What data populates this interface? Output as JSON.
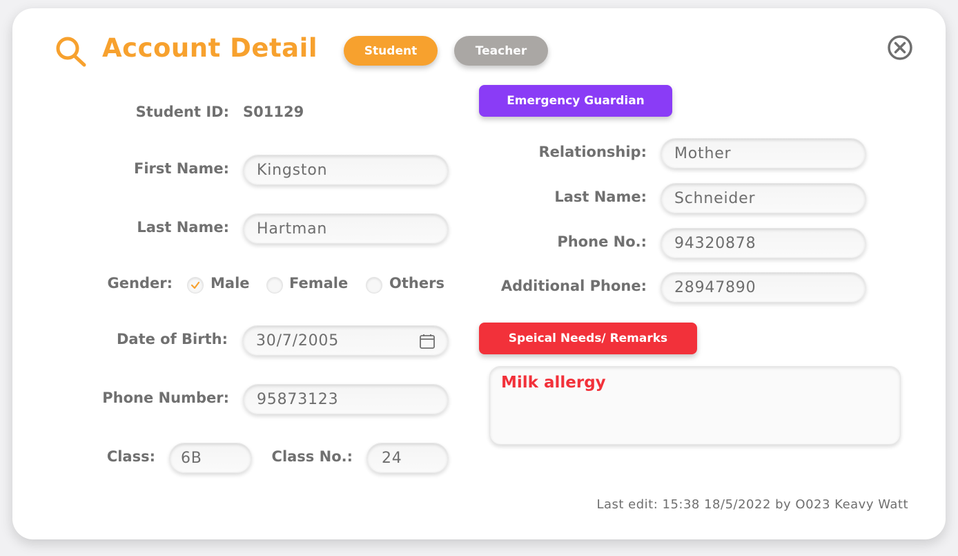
{
  "header": {
    "title": "Account Detail",
    "icon": "search-icon",
    "accent_color": "#f7a12e",
    "tabs": [
      {
        "label": "Student",
        "active": true,
        "color": "#f7a12e"
      },
      {
        "label": "Teacher",
        "active": false,
        "color": "#aaa7a4"
      }
    ]
  },
  "student": {
    "id_label": "Student ID:",
    "id_value": "S01129",
    "first_name_label": "First Name:",
    "first_name": "Kingston",
    "last_name_label": "Last Name:",
    "last_name": "Hartman",
    "gender_label": "Gender:",
    "gender_options": [
      "Male",
      "Female",
      "Others"
    ],
    "gender_selected": "Male",
    "dob_label": "Date of Birth:",
    "dob": "30/7/2005",
    "phone_label": "Phone Number:",
    "phone": "95873123",
    "class_label": "Class:",
    "class": "6B",
    "class_no_label": "Class No.:",
    "class_no": "24"
  },
  "guardian": {
    "section_label": "Emergency Guardian",
    "section_color": "#8a3cf6",
    "relationship_label": "Relationship:",
    "relationship": "Mother",
    "last_name_label": "Last Name:",
    "last_name": "Schneider",
    "phone_label": "Phone No.:",
    "phone": "94320878",
    "additional_phone_label": "Additional Phone:",
    "additional_phone": "28947890"
  },
  "remarks": {
    "section_label": "Speical Needs/ Remarks",
    "section_color": "#f2313a",
    "text": "Milk allergy"
  },
  "footer": {
    "last_edit": "Last edit: 15:38 18/5/2022 by O023 Keavy Watt"
  }
}
